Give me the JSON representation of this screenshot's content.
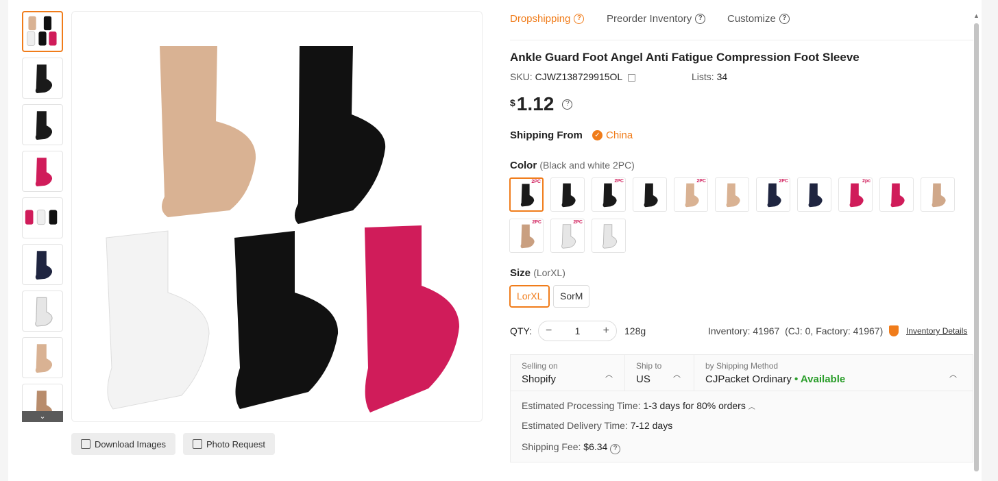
{
  "tabs": [
    {
      "label": "Dropshipping",
      "active": true
    },
    {
      "label": "Preorder Inventory",
      "active": false
    },
    {
      "label": "Customize",
      "active": false
    }
  ],
  "product": {
    "title": "Ankle Guard Foot Angel Anti Fatigue Compression Foot Sleeve",
    "sku_label": "SKU:",
    "sku": "CJWZ138729915OL",
    "lists_label": "Lists:",
    "lists": "34",
    "currency": "$",
    "price": "1.12"
  },
  "shipping_from": {
    "label": "Shipping From",
    "country": "China"
  },
  "color": {
    "label": "Color",
    "selected": "(Black and white 2PC)",
    "swatches": [
      {
        "color": "#1a1a1a",
        "tag": "2PC"
      },
      {
        "color": "#1a1a1a",
        "tag": ""
      },
      {
        "color": "#1a1a1a",
        "tag": "2PC"
      },
      {
        "color": "#1a1a1a",
        "tag": ""
      },
      {
        "color": "#d9b293",
        "tag": "2PC"
      },
      {
        "color": "#d9b293",
        "tag": ""
      },
      {
        "color": "#1f2540",
        "tag": "2PC"
      },
      {
        "color": "#1f2540",
        "tag": ""
      },
      {
        "color": "#d01c5a",
        "tag": "2pc"
      },
      {
        "color": "#d01c5a",
        "tag": ""
      },
      {
        "color": "#d0a88a",
        "tag": ""
      },
      {
        "color": "#c99f80",
        "tag": "2PC"
      },
      {
        "color": "#e6e6e6",
        "tag": "2PC"
      },
      {
        "color": "#e6e6e6",
        "tag": ""
      }
    ]
  },
  "size": {
    "label": "Size",
    "selected": "(LorXL)",
    "options": [
      "LorXL",
      "SorM"
    ]
  },
  "qty": {
    "label": "QTY:",
    "value": "1",
    "minus": "−",
    "plus": "+",
    "weight": "128g"
  },
  "inventory": {
    "text": "Inventory: 41967  (CJ: 0, Factory: 41967)",
    "link": "Inventory Details"
  },
  "shipping": {
    "selling_on_label": "Selling on",
    "selling_on": "Shopify",
    "ship_to_label": "Ship to",
    "ship_to": "US",
    "method_label": "by Shipping Method",
    "method": "CJPacket Ordinary",
    "availability": "• Available",
    "processing_label": "Estimated Processing Time:",
    "processing": "1-3 days for 80% orders",
    "delivery_label": "Estimated Delivery Time:",
    "delivery": "7-12 days",
    "fee_label": "Shipping Fee:",
    "fee": "$6.34"
  },
  "image_buttons": {
    "download": "Download Images",
    "photo": "Photo Request"
  },
  "thumbnails": [
    "multi",
    "#1a1a1a",
    "#1a1a1a",
    "#d01c5a",
    "multi2",
    "#1f2540",
    "#e6e6e6",
    "#d9b293",
    "#b88c6c"
  ],
  "icons": {
    "more": "chevron-down-icon",
    "help": "question-circle-icon",
    "check": "check-circle-icon"
  }
}
